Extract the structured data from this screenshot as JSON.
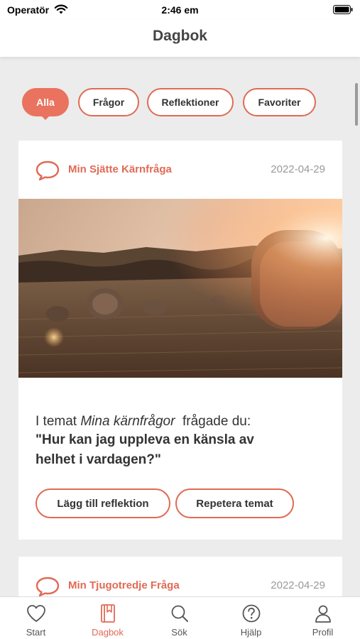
{
  "status_bar": {
    "carrier": "Operatör",
    "time": "2:46 em"
  },
  "nav": {
    "title": "Dagbok"
  },
  "filters": [
    {
      "label": "Alla",
      "active": true
    },
    {
      "label": "Frågor",
      "active": false
    },
    {
      "label": "Reflektioner",
      "active": false
    },
    {
      "label": "Favoriter",
      "active": false
    }
  ],
  "entries": [
    {
      "title": "Min Sjätte Kärnfråga",
      "date": "2022-04-29",
      "intro_prefix": "I temat ",
      "theme": "Mina kärnfrågor",
      "intro_suffix": "  frågade du:",
      "question_line1": "\"Hur kan jag uppleva en känsla av",
      "question_line2": "helhet i vardagen?\"",
      "add_reflection_label": "Lägg till reflektion",
      "repeat_theme_label": "Repetera temat"
    },
    {
      "title": "Min Tjugotredje Fråga",
      "date": "2022-04-29"
    }
  ],
  "tab_bar": {
    "tabs": [
      {
        "label": "Start",
        "icon": "heart-icon",
        "active": false
      },
      {
        "label": "Dagbok",
        "icon": "journal-icon",
        "active": true
      },
      {
        "label": "Sök",
        "icon": "search-icon",
        "active": false
      },
      {
        "label": "Hjälp",
        "icon": "help-icon",
        "active": false
      },
      {
        "label": "Profil",
        "icon": "profile-icon",
        "active": false
      }
    ]
  },
  "colors": {
    "accent": "#e06a55",
    "accent_fill": "#ea735f",
    "background": "#ececec"
  }
}
